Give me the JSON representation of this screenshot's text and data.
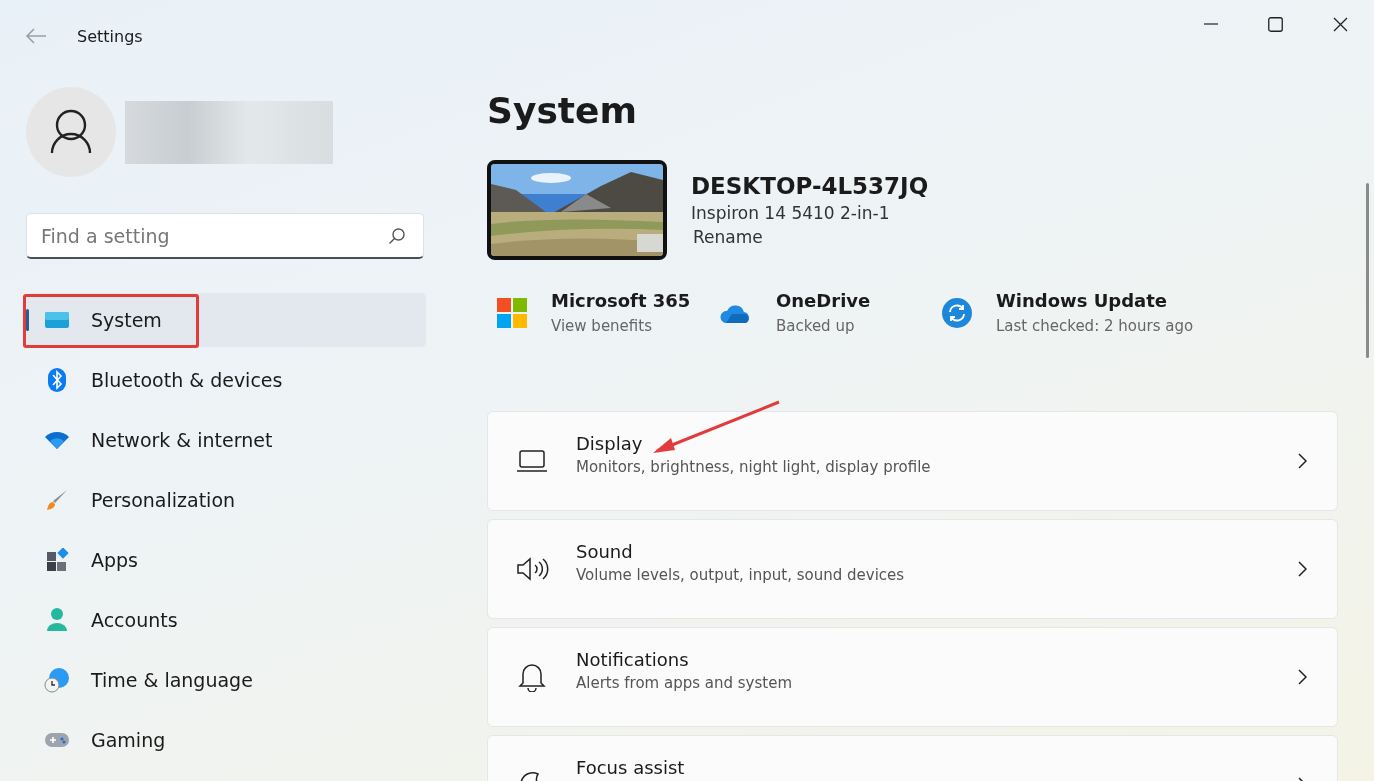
{
  "window": {
    "title": "Settings"
  },
  "search": {
    "placeholder": "Find a setting"
  },
  "nav": [
    {
      "label": "System",
      "selected": true
    },
    {
      "label": "Bluetooth & devices",
      "selected": false
    },
    {
      "label": "Network & internet",
      "selected": false
    },
    {
      "label": "Personalization",
      "selected": false
    },
    {
      "label": "Apps",
      "selected": false
    },
    {
      "label": "Accounts",
      "selected": false
    },
    {
      "label": "Time & language",
      "selected": false
    },
    {
      "label": "Gaming",
      "selected": false
    }
  ],
  "page_title": "System",
  "device": {
    "name": "DESKTOP-4L537JQ",
    "model": "Inspiron 14 5410 2-in-1",
    "rename": "Rename"
  },
  "status": [
    {
      "title": "Microsoft 365",
      "subtitle": "View benefits"
    },
    {
      "title": "OneDrive",
      "subtitle": "Backed up"
    },
    {
      "title": "Windows Update",
      "subtitle": "Last checked: 2 hours ago"
    }
  ],
  "cards": [
    {
      "title": "Display",
      "subtitle": "Monitors, brightness, night light, display profile"
    },
    {
      "title": "Sound",
      "subtitle": "Volume levels, output, input, sound devices"
    },
    {
      "title": "Notifications",
      "subtitle": "Alerts from apps and system"
    },
    {
      "title": "Focus assist"
    }
  ]
}
